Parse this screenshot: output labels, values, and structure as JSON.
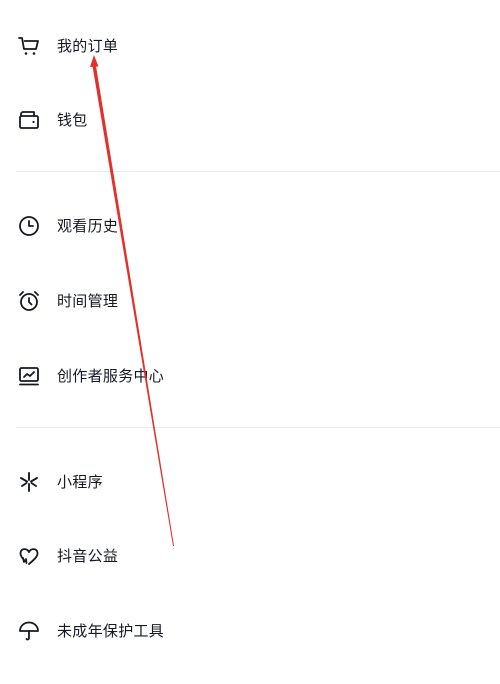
{
  "menu": {
    "items": [
      {
        "label": "我的订单",
        "icon": "cart-icon"
      },
      {
        "label": "钱包",
        "icon": "wallet-icon"
      },
      {
        "label": "观看历史",
        "icon": "clock-icon"
      },
      {
        "label": "时间管理",
        "icon": "alarm-clock-icon"
      },
      {
        "label": "创作者服务中心",
        "icon": "monitor-chart-icon"
      },
      {
        "label": "小程序",
        "icon": "mini-program-icon"
      },
      {
        "label": "抖音公益",
        "icon": "heart-hands-icon"
      },
      {
        "label": "未成年保护工具",
        "icon": "umbrella-icon"
      }
    ]
  },
  "annotation": {
    "color": "#e0322b"
  },
  "colors": {
    "text": "#161823",
    "icon": "#161823",
    "divider": "#ececee",
    "background": "#ffffff"
  }
}
